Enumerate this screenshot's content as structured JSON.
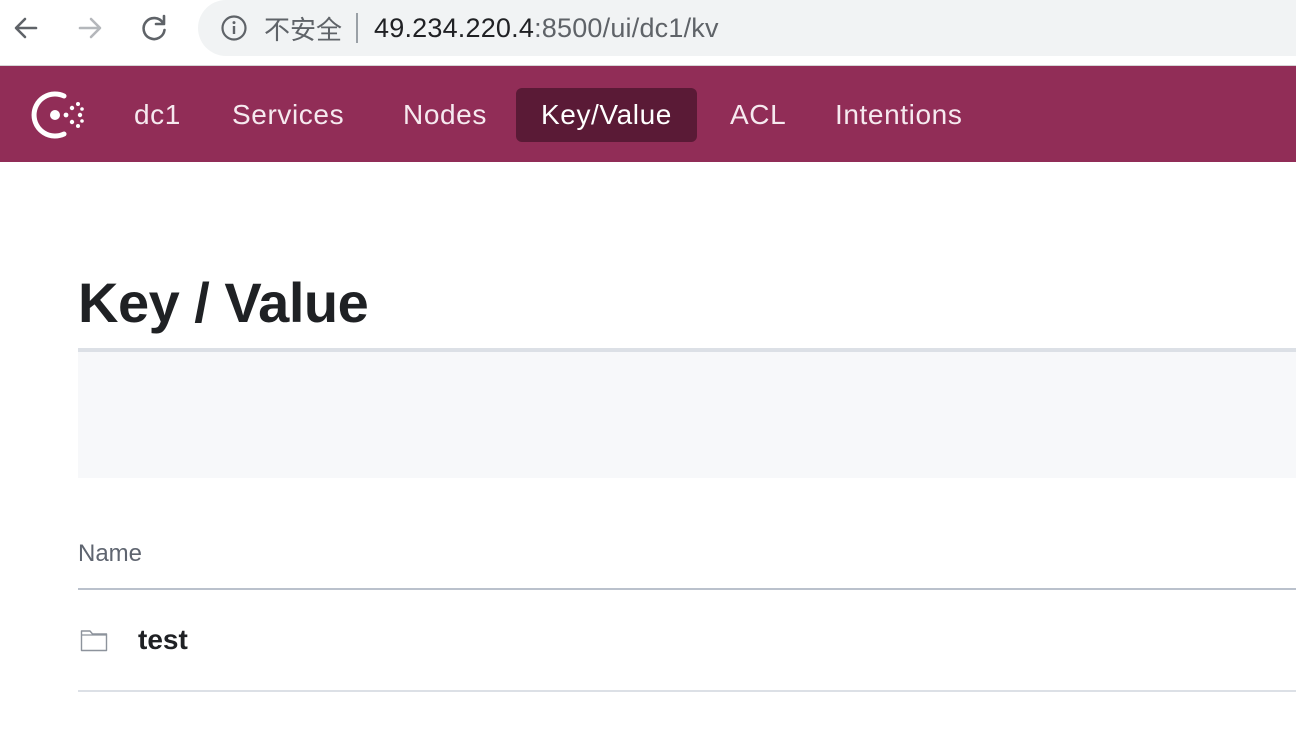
{
  "browser": {
    "security_label": "不安全",
    "url_host": "49.234.220.4",
    "url_rest": ":8500/ui/dc1/kv"
  },
  "header": {
    "brand_color": "#912d57",
    "active_color": "#5a1a36",
    "nav": {
      "datacenter": "dc1",
      "services": "Services",
      "nodes": "Nodes",
      "key_value": "Key/Value",
      "acl": "ACL",
      "intentions": "Intentions"
    },
    "active_item": "Key/Value"
  },
  "main": {
    "title": "Key / Value",
    "table": {
      "columns": [
        "Name"
      ],
      "rows": [
        {
          "name": "test",
          "icon": "folder-icon"
        }
      ]
    }
  }
}
